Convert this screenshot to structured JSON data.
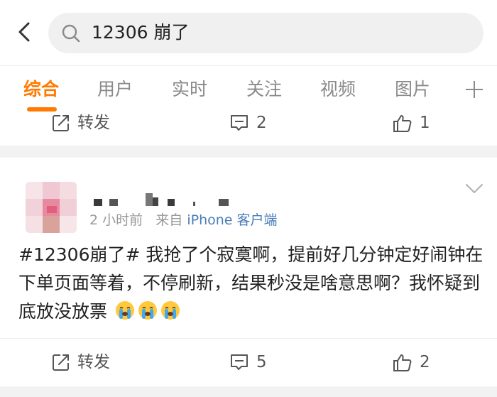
{
  "search": {
    "query": "12306 崩了"
  },
  "tabs": [
    {
      "label": "综合",
      "active": true
    },
    {
      "label": "用户",
      "active": false
    },
    {
      "label": "实时",
      "active": false
    },
    {
      "label": "关注",
      "active": false
    },
    {
      "label": "视频",
      "active": false
    },
    {
      "label": "图片",
      "active": false
    }
  ],
  "previous_post": {
    "repost_label": "转发",
    "comment_count": "2",
    "like_count": "1"
  },
  "post": {
    "time": "2 小时前",
    "from_label": "来自",
    "source": "iPhone 客户端",
    "text": "#12306崩了# 我抢了个寂寞啊，提前好几分钟定好闹钟在下单页面等着，不停刷新，结果秒没是啥意思啊？我怀疑到底放没放票",
    "emoji_count": 3,
    "repost_label": "转发",
    "comment_count": "5",
    "like_count": "2"
  },
  "colors": {
    "accent": "#ff7a00",
    "source_link": "#4a7cb8",
    "icon": "#555555",
    "muted": "#999999"
  },
  "icons": [
    "back-arrow-icon",
    "search-icon",
    "plus-icon",
    "repost-icon",
    "comment-icon",
    "like-icon",
    "chevron-down-icon",
    "crying-face-emoji"
  ]
}
